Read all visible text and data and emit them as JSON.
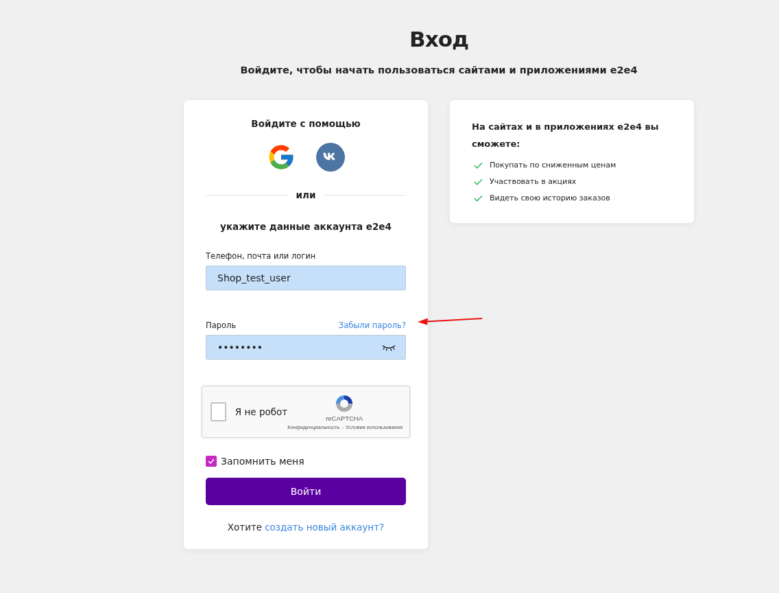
{
  "page": {
    "title": "Вход",
    "subtitle": "Войдите, чтобы начать пользоваться сайтами и приложениями e2e4"
  },
  "login_card": {
    "social_heading": "Войдите с помощью",
    "divider_text": "или",
    "account_heading": "укажите данные аккаунта e2e4",
    "fields": [
      {
        "kind": "text",
        "label": "Телефон, почта или логин",
        "value": "Shop_test_user"
      },
      {
        "kind": "password",
        "label": "Пароль",
        "link": "Забыли пароль?",
        "value": "••••••••"
      }
    ],
    "captcha": {
      "label": "Я не робот",
      "checked": false,
      "brand": "reCAPTCHA",
      "links": [
        "Конфиденциальность",
        "Условия использования"
      ],
      "separator": "-"
    },
    "remember": {
      "label": "Запомнить меня",
      "checked": true
    },
    "submit": "Войти",
    "signup": {
      "text": "Хотите",
      "link": "создать новый аккаунт?"
    }
  },
  "benefits_card": {
    "heading": "На сайтах и в приложениях e2e4 вы сможете:",
    "items": [
      "Покупать по сниженным ценам",
      "Участвовать в акциях",
      "Видеть свою историю заказов"
    ]
  }
}
